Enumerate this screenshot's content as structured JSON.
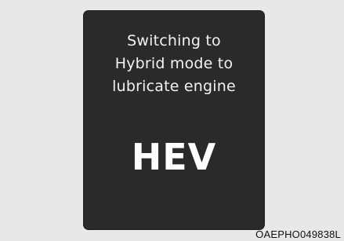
{
  "display": {
    "message_lines": [
      "Switching to",
      "Hybrid mode to",
      "lubricate engine"
    ],
    "mode_label": "HEV"
  },
  "figure_code": "OAEPHO049838L",
  "colors": {
    "page_background": "#e8e8e8",
    "panel_background": "#2a2a2a",
    "panel_text": "#f2f2f2",
    "code_text": "#111111"
  }
}
